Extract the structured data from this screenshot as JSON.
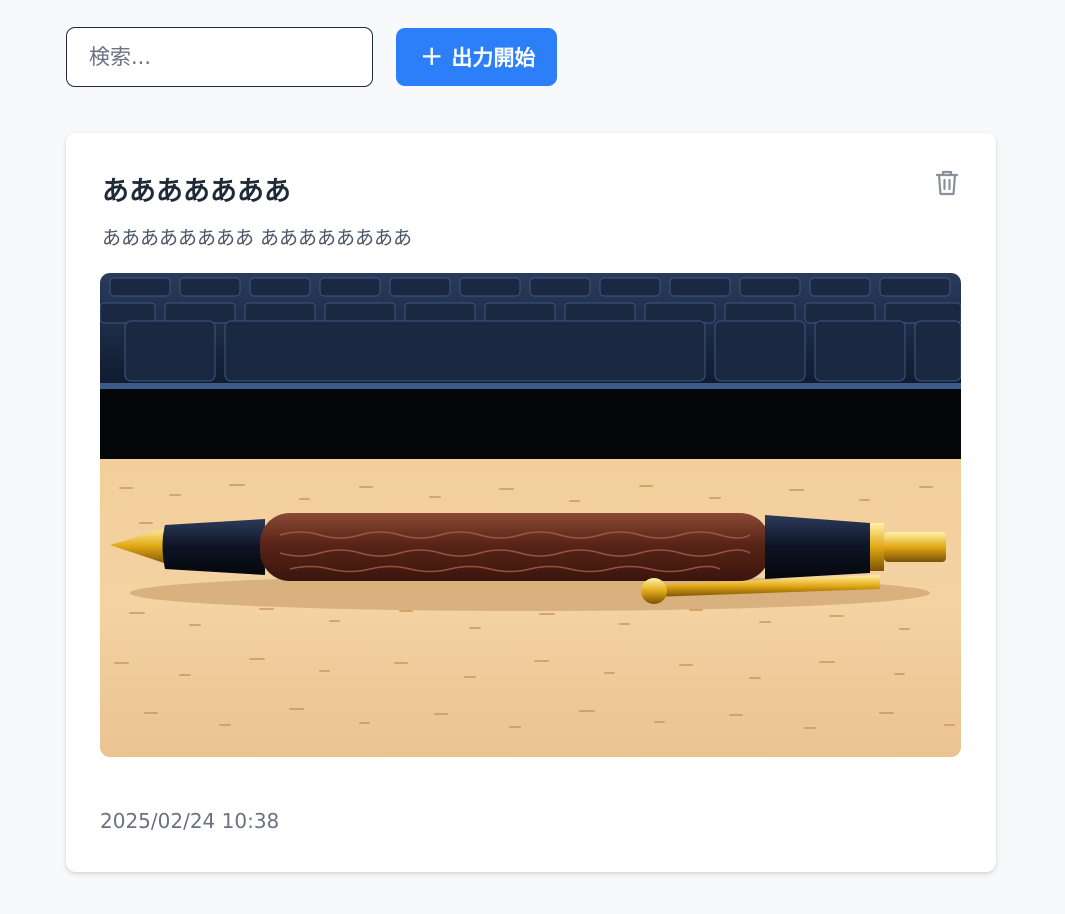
{
  "search": {
    "placeholder": "検索..."
  },
  "toolbar": {
    "start_icon": "plus-icon",
    "start_label": "出力開始"
  },
  "card": {
    "title": "あああああああ",
    "description": "ああああああああ ああああああああ",
    "delete_icon": "trash-icon",
    "photo_subject": "pen-on-desk-photo",
    "timestamp": "2025/02/24 10:38"
  },
  "colors": {
    "accent": "#2d7ff9",
    "background": "#f8f9fb",
    "card": "#ffffff",
    "title_text": "#1f2937",
    "muted_text": "#6b7280"
  }
}
